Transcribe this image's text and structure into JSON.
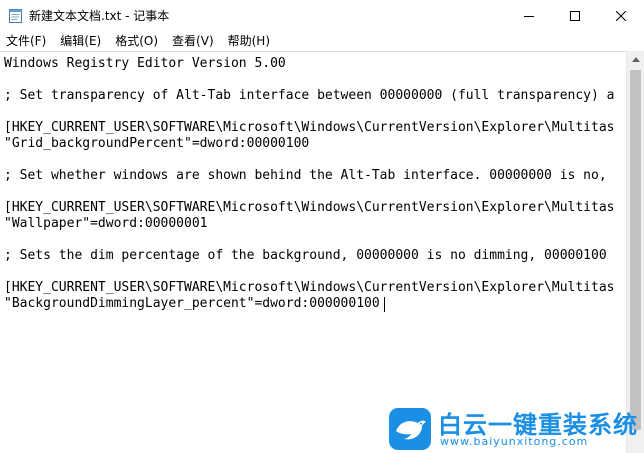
{
  "window": {
    "title": "新建文本文档.txt - 记事本",
    "icon": "notepad-icon"
  },
  "controls": {
    "minimize_icon": "minimize-icon",
    "maximize_icon": "maximize-icon",
    "close_icon": "close-icon"
  },
  "menu": [
    {
      "label": "文件(F)"
    },
    {
      "label": "编辑(E)"
    },
    {
      "label": "格式(O)"
    },
    {
      "label": "查看(V)"
    },
    {
      "label": "帮助(H)"
    }
  ],
  "editor": {
    "lines": [
      "Windows Registry Editor Version 5.00",
      "",
      "; Set transparency of Alt-Tab interface between 00000000 (full transparency) a",
      "",
      "[HKEY_CURRENT_USER\\SOFTWARE\\Microsoft\\Windows\\CurrentVersion\\Explorer\\Multitas",
      "\"Grid_backgroundPercent\"=dword:00000100",
      "",
      "; Set whether windows are shown behind the Alt-Tab interface. 00000000 is no,",
      "",
      "[HKEY_CURRENT_USER\\SOFTWARE\\Microsoft\\Windows\\CurrentVersion\\Explorer\\Multitas",
      "\"Wallpaper\"=dword:00000001",
      "",
      "; Sets the dim percentage of the background, 00000000 is no dimming, 00000100",
      "",
      "[HKEY_CURRENT_USER\\SOFTWARE\\Microsoft\\Windows\\CurrentVersion\\Explorer\\Multitas",
      "\"BackgroundDimmingLayer_percent\"=dword:000000100"
    ]
  },
  "watermark": {
    "name": "白云一键重装系统",
    "url": "www.baiyunxitong.com",
    "color": "#1a8fe3"
  }
}
